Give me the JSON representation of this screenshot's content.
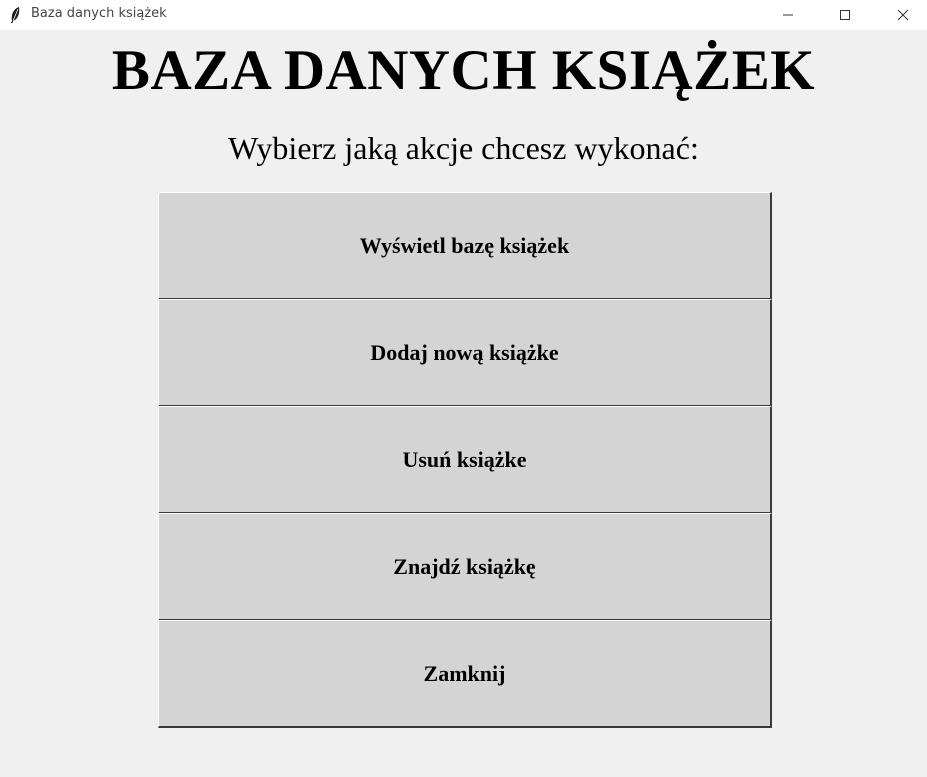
{
  "window": {
    "title": "Baza danych książek",
    "app_icon": "feather-icon",
    "controls": [
      "minimize-icon",
      "maximize-icon",
      "close-icon"
    ]
  },
  "main": {
    "heading": "BAZA DANYCH KSIĄŻEK",
    "subheading": "Wybierz jaką akcje chcesz wykonać:",
    "buttons": [
      {
        "label": "Wyświetl bazę książek"
      },
      {
        "label": "Dodaj nową książke"
      },
      {
        "label": "Usuń książke"
      },
      {
        "label": "Znajdź książkę"
      },
      {
        "label": "Zamknij"
      }
    ]
  },
  "colors": {
    "window_bg": "#f0f0f0",
    "button_bg": "#d4d4d4",
    "titlebar_bg": "#ffffff"
  }
}
